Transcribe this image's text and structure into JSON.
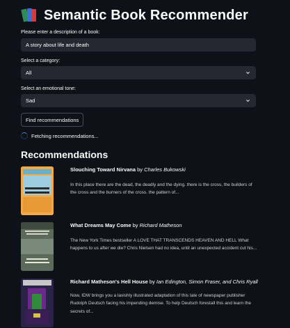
{
  "app": {
    "title": "Semantic Book Recommender"
  },
  "form": {
    "description": {
      "label": "Please enter a description of a book:",
      "value": "A story about life and death"
    },
    "category": {
      "label": "Select a category:",
      "value": "All"
    },
    "tone": {
      "label": "Select an emotional tone:",
      "value": "Sad"
    },
    "submit_label": "Find recommendations"
  },
  "status": {
    "text": "Fetching recommendations..."
  },
  "recommendations": {
    "heading": "Recommendations",
    "items": [
      {
        "title": "Slouching Toward Nirvana",
        "by": "by",
        "author": "Charles Bukowski",
        "description": "In this place there are the dead, the deadly and the dying. there is the cross, the builders of the cross and the burners of the cross. the pattern of..."
      },
      {
        "title": "What Dreams May Come",
        "by": "by",
        "author": "Richard Matheson",
        "description": "The New York Times bestseller A LOVE THAT TRANSCENDS HEAVEN AND HELL What happens to us after we die? Chris Nielsen had no idea, until an unexpected accident cut his..."
      },
      {
        "title": "Richard Matheson's Hell House",
        "by": "by",
        "author": "Ian Edington, Simon Fraser, and Chris Ryall",
        "description": "Now, IDW brings you a lavishly illustrated adaptation of this tale of newspaper publisher Rudolph Deutsch facing his impending demise. To help Deutsch forestall this and learn the secrets of..."
      }
    ]
  },
  "colors": {
    "background": "#0e1117",
    "input_bg": "#262730",
    "spinner_accent": "#4c8bd6"
  }
}
